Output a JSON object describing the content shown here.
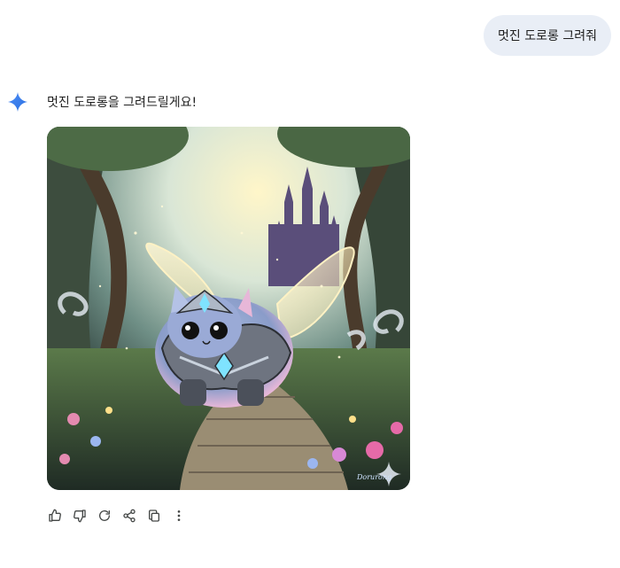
{
  "user_message": "멋진 도로롱 그려줘",
  "assistant": {
    "text": "멋진 도로롱을 그려드릴게요!",
    "icon": "gemini-sparkle-icon",
    "image": {
      "signature": "Dorurong"
    }
  },
  "actions": [
    {
      "name": "thumbs-up-icon"
    },
    {
      "name": "thumbs-down-icon"
    },
    {
      "name": "regenerate-icon"
    },
    {
      "name": "share-icon"
    },
    {
      "name": "copy-icon"
    },
    {
      "name": "more-options-icon"
    }
  ],
  "colors": {
    "accent": "#4285f4",
    "bubble": "#e9eef6",
    "icon_gray": "#444746"
  }
}
